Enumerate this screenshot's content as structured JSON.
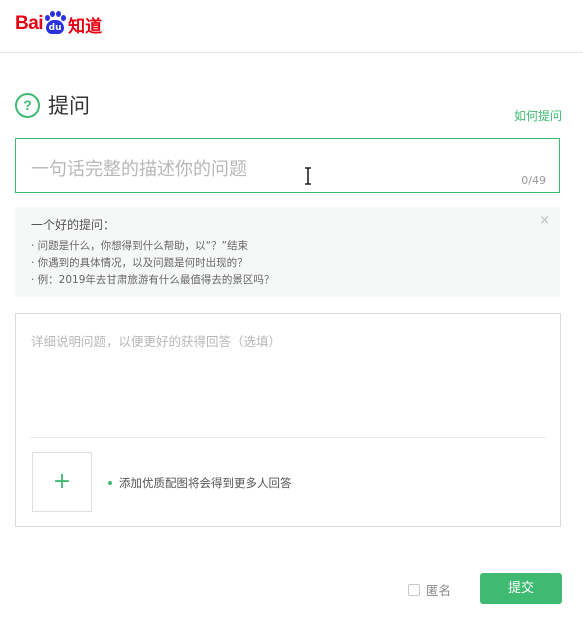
{
  "header": {
    "logo": {
      "bai": "Bai",
      "du": "du",
      "zhidao": "知道"
    }
  },
  "ask": {
    "title": "提问",
    "help_icon": "question-circle-icon",
    "how_to_ask": "如何提问"
  },
  "title_input": {
    "placeholder": "一句话完整的描述你的问题",
    "counter": "0/49"
  },
  "tips": {
    "heading": "一个好的提问：",
    "items": [
      "· 问题是什么，你想得到什么帮助，以“？”结束",
      "· 你遇到的具体情况，以及问题是何时出现的？",
      "· 例：2019年去甘肃旅游有什么最值得去的景区吗？"
    ],
    "close": "×"
  },
  "detail": {
    "placeholder": "详细说明问题，以便更好的获得回答（选填）",
    "add_image": "+",
    "image_hint": "添加优质配图将会得到更多人回答"
  },
  "footer": {
    "anonymous_label": "匿名",
    "anonymous_checked": false,
    "submit_label": "提交"
  },
  "colors": {
    "accent": "#3fba72",
    "brand_red": "#e60012",
    "brand_blue": "#2932e1"
  }
}
